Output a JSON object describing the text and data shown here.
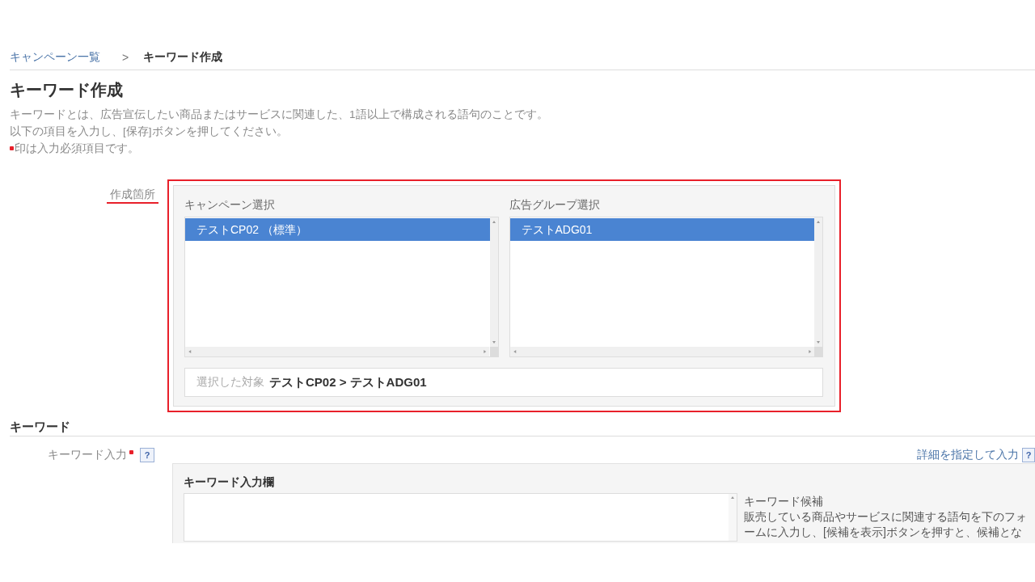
{
  "breadcrumb": [
    {
      "kind": "link",
      "label": "キャンペーン一覧"
    },
    {
      "kind": "separator",
      "label": ">"
    },
    {
      "kind": "current",
      "label": "キーワード作成"
    }
  ],
  "page_title": "キーワード作成",
  "description": [
    {
      "text": "キーワードとは、広告宣伝したい商品またはサービスに関連した、1語以上で構成される語句のことです。",
      "required_mark": false
    },
    {
      "text": "以下の項目を入力し、[保存]ボタンを押してください。",
      "required_mark": false
    },
    {
      "text": "印は入力必須項目です。",
      "required_mark": true
    }
  ],
  "placement": {
    "label": "作成箇所",
    "highlighted": true,
    "lists": [
      {
        "label": "キャンペーン選択",
        "items": [
          {
            "label": "テストCP02 （標準）",
            "selected": true
          }
        ]
      },
      {
        "label": "広告グループ選択",
        "items": [
          {
            "label": "テストADG01",
            "selected": true
          }
        ]
      }
    ],
    "selected_target": {
      "label": "選択した対象",
      "value": "テストCP02 > テストADG01"
    }
  },
  "keyword_section": {
    "heading": "キーワード",
    "field_label": "キーワード入力",
    "required": true,
    "help": "?",
    "detail_link": "詳細を指定して入力",
    "detail_help": "?",
    "input_title": "キーワード入力欄",
    "candidates": {
      "title": "キーワード候補",
      "text": "販売している商品やサービスに関連する語句を下のフォームに入力し、[候補を表示]ボタンを押すと、候補とな"
    }
  }
}
